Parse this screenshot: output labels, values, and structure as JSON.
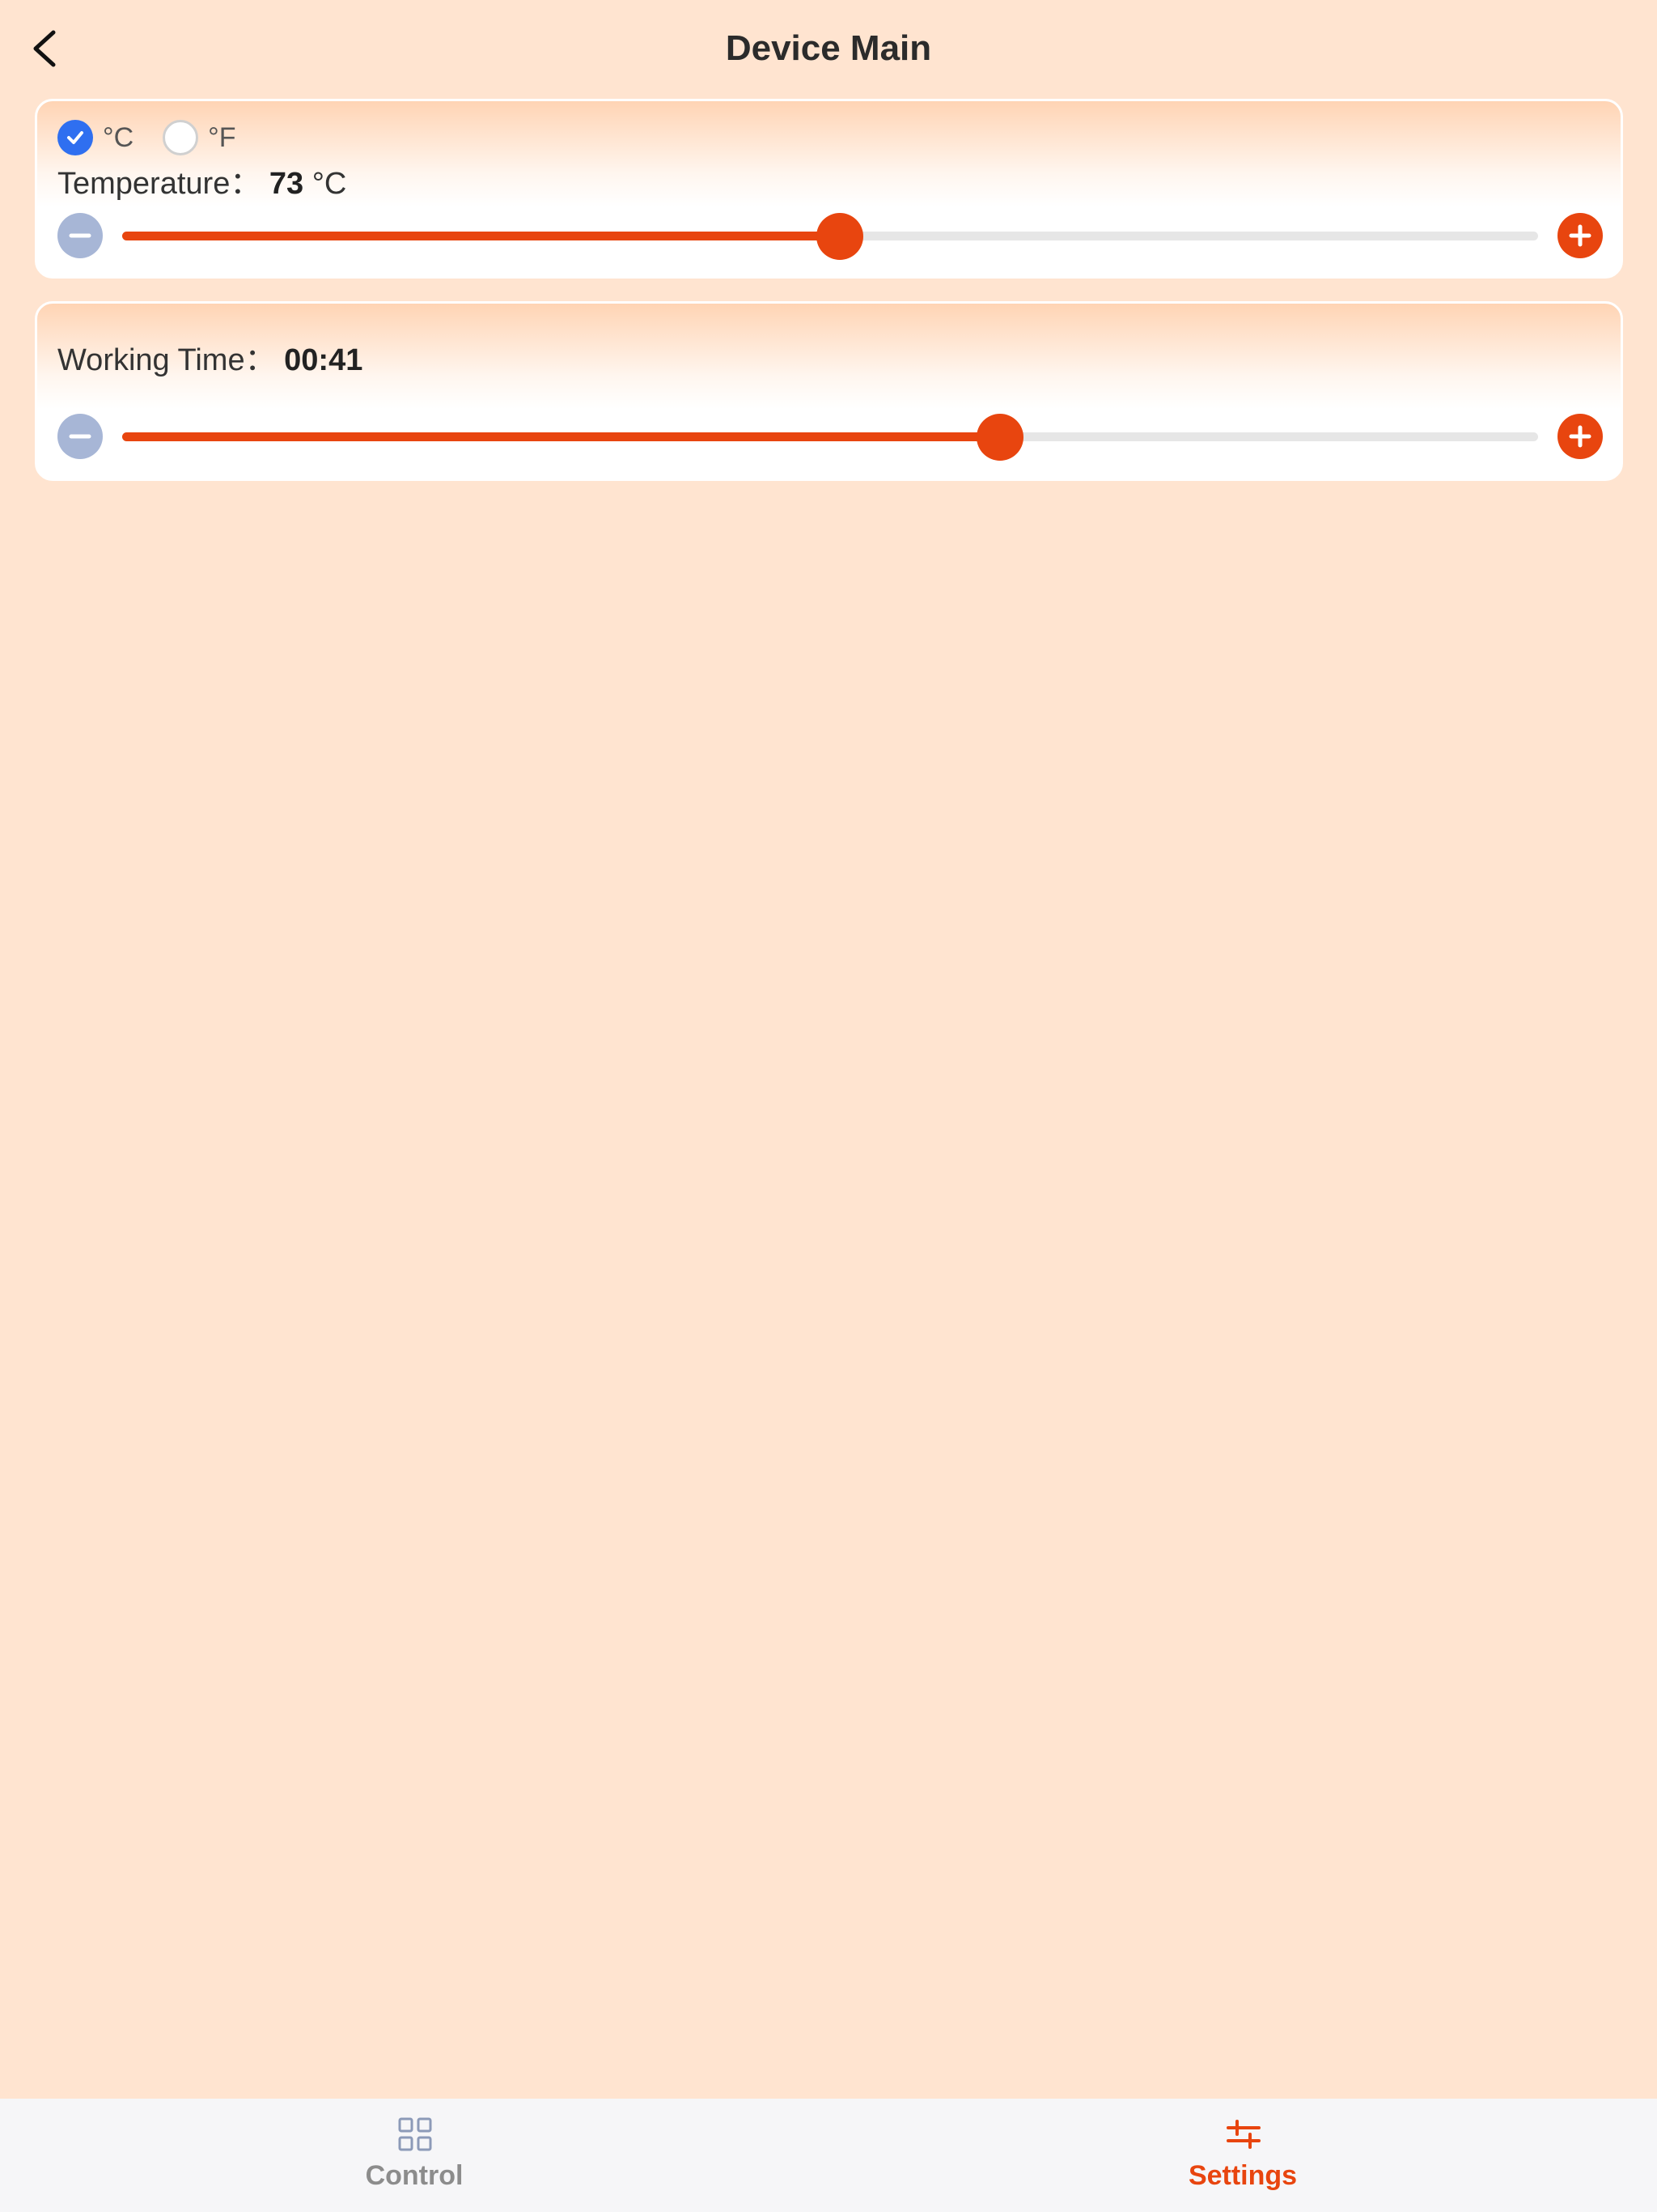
{
  "header": {
    "title": "Device Main",
    "back_icon": "chevron-left-icon"
  },
  "temperature_card": {
    "units": [
      {
        "label": "°C",
        "checked": true
      },
      {
        "label": "°F",
        "checked": false
      }
    ],
    "label": "Temperature：",
    "value": "73",
    "unit": "°C",
    "slider_fraction": 0.507
  },
  "working_time_card": {
    "label": "Working Time：",
    "value": "00:41",
    "slider_fraction": 0.62
  },
  "tabs": [
    {
      "label": "Control",
      "icon": "grid-icon",
      "active": false
    },
    {
      "label": "Settings",
      "icon": "sliders-icon",
      "active": true
    }
  ],
  "colors": {
    "background": "#ffe4d0",
    "accent": "#e8450f",
    "radio_checked": "#2f6ff0",
    "minus_button": "#a7b6d6",
    "inactive_tab": "#8c8c8c"
  }
}
